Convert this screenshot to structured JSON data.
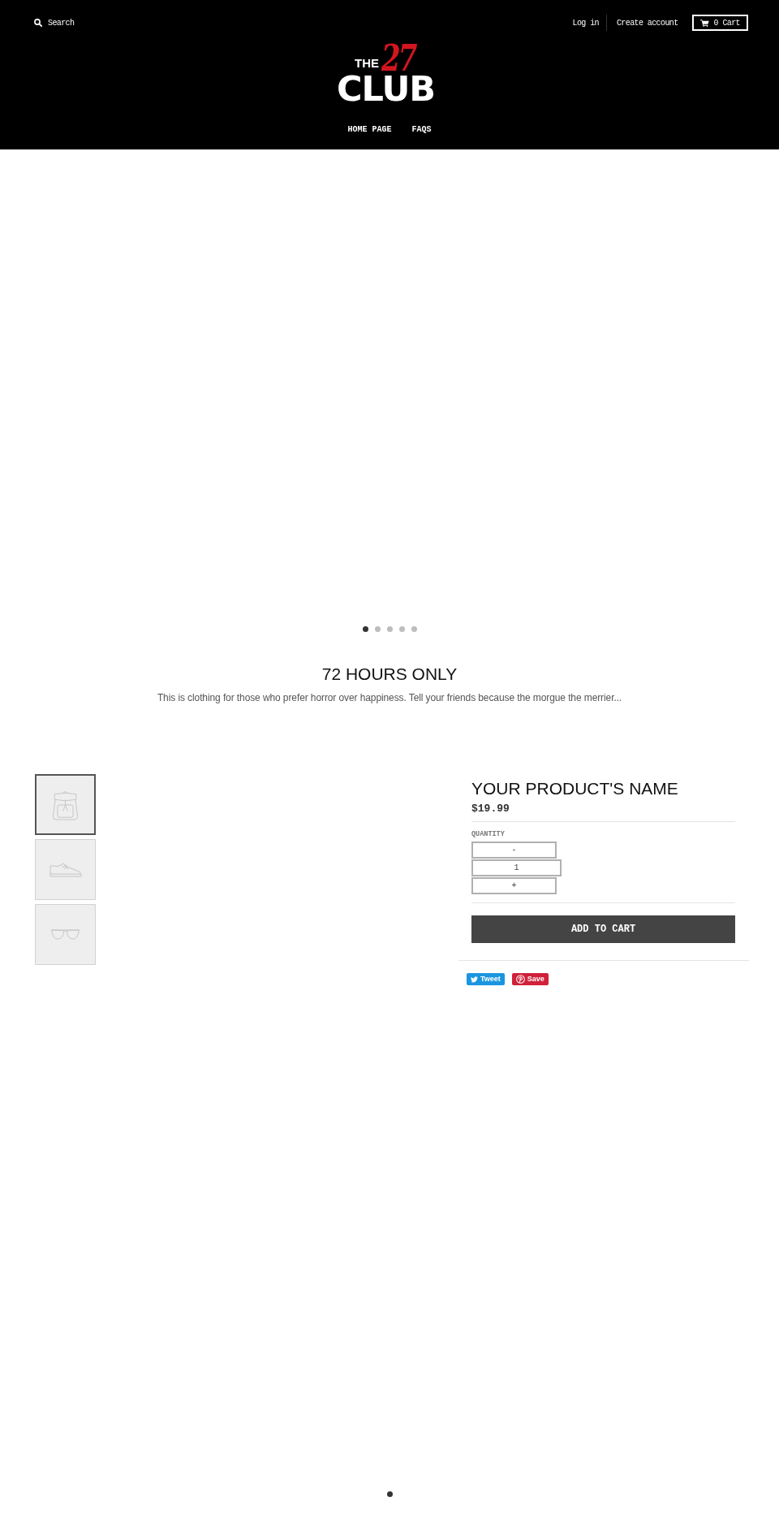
{
  "header": {
    "search": {
      "label": "Search"
    },
    "account_links": [
      {
        "label": "Log in"
      },
      {
        "label": "Create account"
      }
    ],
    "cart": {
      "label": "0 Cart"
    },
    "logo": {
      "line_1": "THE",
      "numeral": "27",
      "line_2": "CLUB"
    },
    "nav": [
      {
        "label": "HOME PAGE"
      },
      {
        "label": "FAQS"
      }
    ]
  },
  "slideshow": {
    "dots": [
      {
        "selected": true
      },
      {
        "selected": false
      },
      {
        "selected": false
      },
      {
        "selected": false
      },
      {
        "selected": false
      }
    ]
  },
  "intro": {
    "title": "72 HOURS ONLY",
    "text": "This is clothing for those who prefer horror over happiness. Tell your friends because the morgue the merrier..."
  },
  "product": {
    "thumbnails": [
      {
        "kind": "backpack",
        "selected": true
      },
      {
        "kind": "sneaker",
        "selected": false
      },
      {
        "kind": "sunglasses",
        "selected": false
      }
    ],
    "name": "YOUR PRODUCT'S NAME",
    "price": "$19.99",
    "quantity": {
      "label": "QUANTITY",
      "decrease": "-",
      "value": "1",
      "increase": "+"
    },
    "add_to_cart": "ADD TO CART",
    "share": [
      {
        "kind": "twitter",
        "label": "Tweet"
      },
      {
        "kind": "pinterest",
        "label": "Save"
      }
    ],
    "image_dots": [
      {
        "selected": true
      }
    ]
  }
}
